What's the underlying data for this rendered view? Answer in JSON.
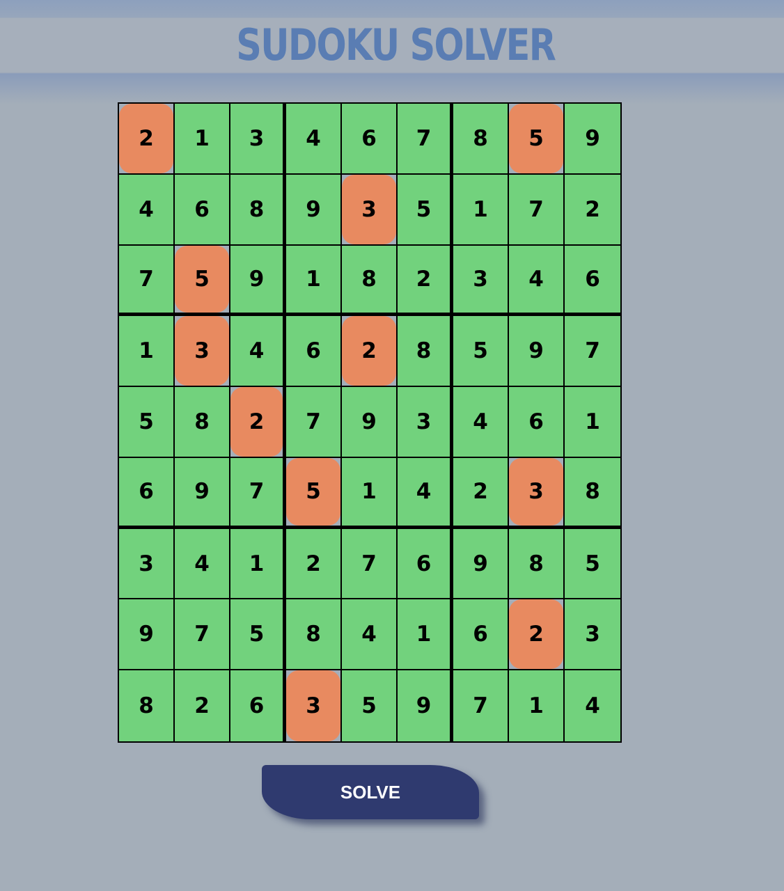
{
  "header": {
    "title": "SUDOKU SOLVER"
  },
  "board": {
    "rows": [
      [
        2,
        1,
        3,
        4,
        6,
        7,
        8,
        5,
        9
      ],
      [
        4,
        6,
        8,
        9,
        3,
        5,
        1,
        7,
        2
      ],
      [
        7,
        5,
        9,
        1,
        8,
        2,
        3,
        4,
        6
      ],
      [
        1,
        3,
        4,
        6,
        2,
        8,
        5,
        9,
        7
      ],
      [
        5,
        8,
        2,
        7,
        9,
        3,
        4,
        6,
        1
      ],
      [
        6,
        9,
        7,
        5,
        1,
        4,
        2,
        3,
        8
      ],
      [
        3,
        4,
        1,
        2,
        7,
        6,
        9,
        8,
        5
      ],
      [
        9,
        7,
        5,
        8,
        4,
        1,
        6,
        2,
        3
      ],
      [
        8,
        2,
        6,
        3,
        5,
        9,
        7,
        1,
        4
      ]
    ],
    "given": [
      [
        0,
        0
      ],
      [
        0,
        7
      ],
      [
        1,
        4
      ],
      [
        2,
        1
      ],
      [
        3,
        1
      ],
      [
        3,
        4
      ],
      [
        4,
        2
      ],
      [
        5,
        3
      ],
      [
        5,
        7
      ],
      [
        7,
        7
      ],
      [
        8,
        3
      ]
    ],
    "colors": {
      "solved_cell": "#72d27d",
      "given_cell": "#e88a60",
      "grid_line": "#000000"
    }
  },
  "actions": {
    "solve_label": "SOLVE",
    "solve_color": "#2f3a6f"
  },
  "theme": {
    "background": "#a4aeb9",
    "title_color": "#5a7db3"
  }
}
